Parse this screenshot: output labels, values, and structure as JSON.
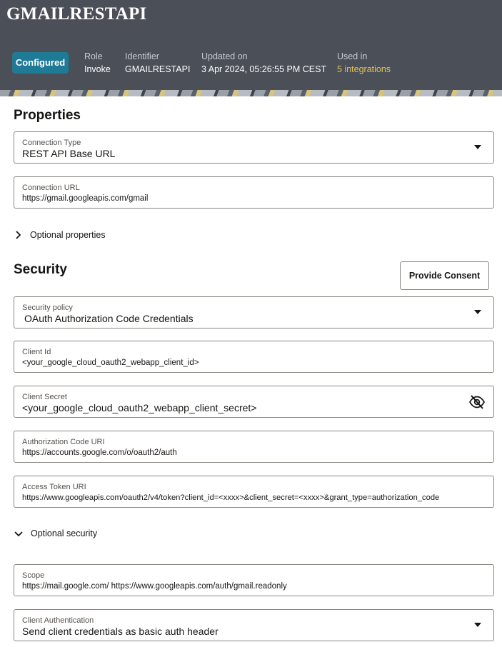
{
  "header": {
    "title": "GMAILRESTAPI",
    "status_badge": "Configured",
    "status_color": "#1f7a96",
    "meta": [
      {
        "key": "Role",
        "value": "Invoke"
      },
      {
        "key": "Identifier",
        "value": "GMAILRESTAPI"
      },
      {
        "key": "Updated on",
        "value": "3 Apr 2024, 05:26:55 PM CEST"
      },
      {
        "key": "Used in",
        "value": "5 integrations"
      }
    ]
  },
  "properties": {
    "title": "Properties",
    "connection_type": {
      "label": "Connection Type",
      "value": "REST API Base URL"
    },
    "connection_url": {
      "label": "Connection URL",
      "value": "https://gmail.googleapis.com/gmail"
    },
    "optional_toggle": "Optional properties"
  },
  "security": {
    "title": "Security",
    "consent_button": "Provide Consent",
    "policy": {
      "label": "Security policy",
      "value": "OAuth Authorization Code Credentials"
    },
    "client_id": {
      "label": "Client Id",
      "value": "<your_google_cloud_oauth2_webapp_client_id>"
    },
    "client_secret": {
      "label": "Client Secret",
      "value": "<your_google_cloud_oauth2_webapp_client_secret>"
    },
    "auth_code_uri": {
      "label": "Authorization Code URI",
      "value": "https://accounts.google.com/o/oauth2/auth"
    },
    "access_token_uri": {
      "label": "Access Token URI",
      "value": "https://www.googleapis.com/oauth2/v4/token?client_id=<xxxx>&client_secret=<xxxx>&grant_type=authorization_code"
    },
    "optional_toggle": "Optional security",
    "scope": {
      "label": "Scope",
      "value": "https://mail.google.com/ https://www.googleapis.com/auth/gmail.readonly"
    },
    "client_auth": {
      "label": "Client Authentication",
      "value": "Send client credentials as basic auth header"
    }
  },
  "icons": {
    "caret": "chevron-down-icon",
    "collapsed": "chevron-right-icon",
    "expanded": "chevron-down-icon",
    "secret": "eye-slash-icon"
  }
}
